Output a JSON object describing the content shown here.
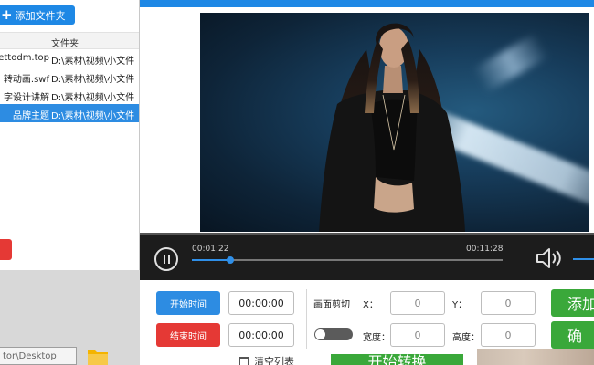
{
  "left_panel": {
    "add_folder_label": "添加文件夹",
    "column_header": "文件夹",
    "files": [
      {
        "name": "zettodm.top",
        "path": "D:\\素材\\视频\\小文件",
        "selected": false
      },
      {
        "name": "转动画.swf",
        "path": "D:\\素材\\视频\\小文件",
        "selected": false
      },
      {
        "name": "字设计讲解",
        "path": "D:\\素材\\视频\\小文件",
        "selected": false
      },
      {
        "name": "品牌主题",
        "path": "D:\\素材\\视频\\小文件",
        "selected": true
      }
    ]
  },
  "player": {
    "current_time": "00:01:22",
    "total_time": "00:11:28",
    "progress": 0.124
  },
  "controls": {
    "start_time_button": "开始时间",
    "end_time_button": "结束时间",
    "start_time_value": "00:00:00",
    "end_time_value": "00:00:00",
    "crop_label": "画面剪切",
    "x_label": "X：",
    "y_label": "Y：",
    "width_label": "宽度：",
    "height_label": "高度：",
    "x_value": "0",
    "y_value": "0",
    "width_value": "0",
    "height_value": "0",
    "add_button": "添加",
    "confirm_button": "确"
  },
  "footer": {
    "path_text": "tor\\Desktop",
    "clear_list_label": "清空列表",
    "start_convert_label": "开始转换"
  },
  "colors": {
    "accent_blue": "#2d8ce2",
    "danger_red": "#e53935",
    "success_green": "#3aa83a",
    "player_bg": "#1c1c1c"
  }
}
